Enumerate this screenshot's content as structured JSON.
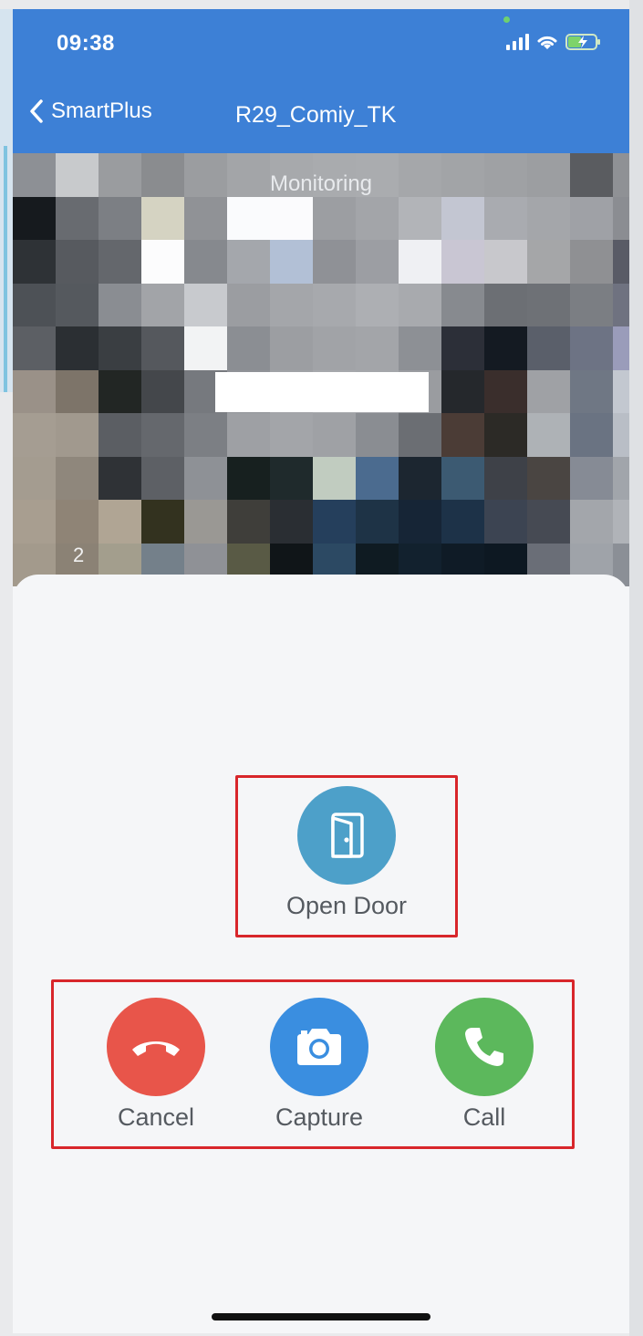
{
  "status_bar": {
    "time": "09:38"
  },
  "nav": {
    "back_label": "SmartPlus",
    "title": "R29_Comiy_TK"
  },
  "video": {
    "label": "Monitoring",
    "camera_number": "2"
  },
  "actions": {
    "open_door": "Open Door",
    "cancel": "Cancel",
    "capture": "Capture",
    "call": "Call"
  },
  "colors": {
    "header": "#3d80d6",
    "open_door": "#4da0c9",
    "cancel": "#e8554a",
    "capture": "#3a8ee0",
    "call": "#5cb85c",
    "highlight_box": "#d8262b"
  },
  "icons": {
    "back": "chevron-left-icon",
    "open_door": "door-icon",
    "cancel": "hang-up-icon",
    "capture": "camera-icon",
    "call": "phone-icon"
  }
}
